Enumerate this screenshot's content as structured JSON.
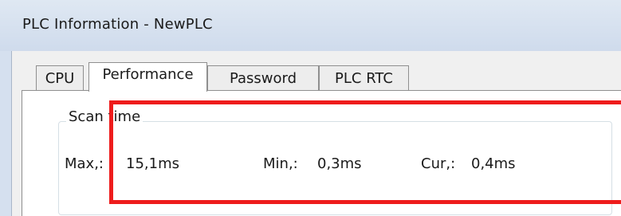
{
  "window": {
    "title": "PLC Information - NewPLC"
  },
  "tabs": [
    {
      "label": "CPU"
    },
    {
      "label": "Performance"
    },
    {
      "label": "Password"
    },
    {
      "label": "PLC RTC"
    }
  ],
  "active_tab": "Performance",
  "scan_time": {
    "group_label": "Scan time",
    "max": {
      "label": "Max,:",
      "value": "15,1ms"
    },
    "min": {
      "label": "Min,:",
      "value": "0,3ms"
    },
    "cur": {
      "label": "Cur,:",
      "value": "0,4ms"
    }
  },
  "highlight_color": "#ee1c1c"
}
